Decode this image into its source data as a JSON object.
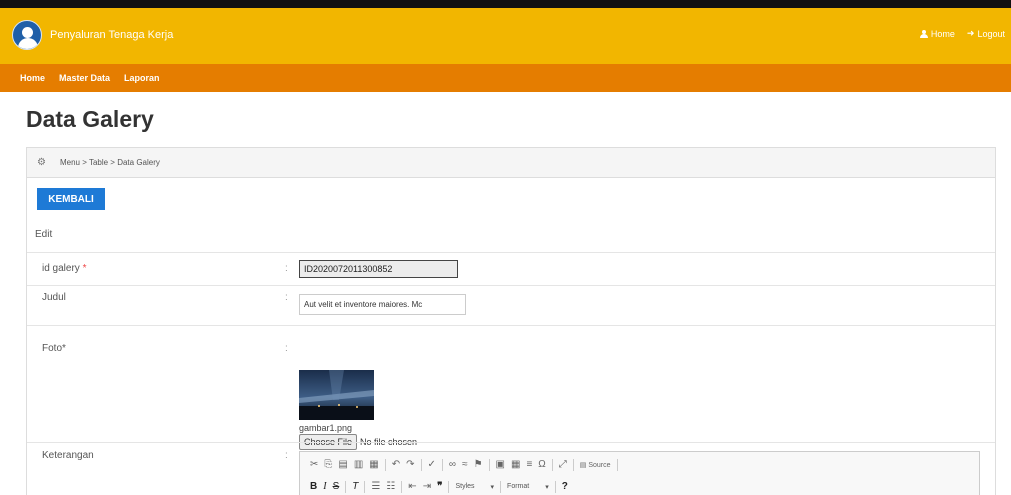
{
  "header": {
    "app_title": "Penyaluran Tenaga Kerja",
    "home_link": "Home",
    "logout_link": "Logout"
  },
  "nav": {
    "items": [
      "Home",
      "Master Data",
      "Laporan"
    ]
  },
  "page": {
    "title": "Data Galery"
  },
  "breadcrumb": {
    "text": "Menu > Table > Data Galery"
  },
  "actions": {
    "back_label": "KEMBALI"
  },
  "form": {
    "mode_label": "Edit",
    "id_field": {
      "label": "id galery",
      "required_mark": "*",
      "value": "ID2020072011300852"
    },
    "judul_field": {
      "label": "Judul",
      "value": "Aut velit et inventore maiores. Mc"
    },
    "foto_field": {
      "label": "Foto*",
      "filename": "gambar1.png",
      "choose_label": "Choose File",
      "no_file_text": "No file chosen"
    },
    "keterangan_field": {
      "label": "Keterangan"
    },
    "colon": ":"
  },
  "editor": {
    "source_label": "Source",
    "styles_label": "Styles",
    "format_label": "Format",
    "help_label": "?"
  },
  "colors": {
    "topbar": "#f2b600",
    "navbar": "#e57d00",
    "button": "#1e7ad6"
  }
}
